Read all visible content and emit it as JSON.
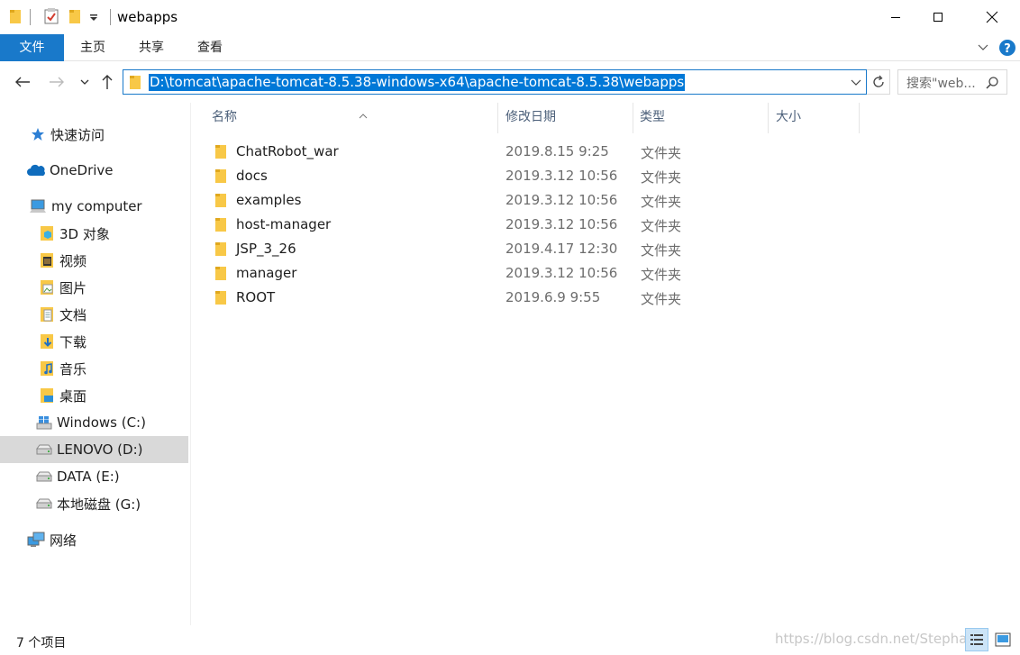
{
  "window": {
    "title": "webapps",
    "minimize_label": "minimize",
    "maximize_label": "maximize",
    "close_label": "close"
  },
  "ribbon": {
    "tabs": [
      {
        "label": "文件"
      },
      {
        "label": "主页"
      },
      {
        "label": "共享"
      },
      {
        "label": "查看"
      }
    ]
  },
  "address": {
    "path": "D:\\tomcat\\apache-tomcat-8.5.38-windows-x64\\apache-tomcat-8.5.38\\webapps"
  },
  "search": {
    "placeholder": "搜索\"web..."
  },
  "nav_pane": {
    "quick_access": "快速访问",
    "onedrive": "OneDrive",
    "this_pc": "my computer",
    "items": [
      {
        "label": "3D 对象"
      },
      {
        "label": "视频"
      },
      {
        "label": "图片"
      },
      {
        "label": "文档"
      },
      {
        "label": "下载"
      },
      {
        "label": "音乐"
      },
      {
        "label": "桌面"
      },
      {
        "label": "Windows (C:)"
      },
      {
        "label": "LENOVO (D:)"
      },
      {
        "label": "DATA (E:)"
      },
      {
        "label": "本地磁盘 (G:)"
      }
    ],
    "network": "网络"
  },
  "columns": {
    "name": "名称",
    "date": "修改日期",
    "type": "类型",
    "size": "大小"
  },
  "files": [
    {
      "name": "ChatRobot_war",
      "date": "2019.8.15 9:25",
      "type": "文件夹"
    },
    {
      "name": "docs",
      "date": "2019.3.12 10:56",
      "type": "文件夹"
    },
    {
      "name": "examples",
      "date": "2019.3.12 10:56",
      "type": "文件夹"
    },
    {
      "name": "host-manager",
      "date": "2019.3.12 10:56",
      "type": "文件夹"
    },
    {
      "name": "JSP_3_26",
      "date": "2019.4.17 12:30",
      "type": "文件夹"
    },
    {
      "name": "manager",
      "date": "2019.3.12 10:56",
      "type": "文件夹"
    },
    {
      "name": "ROOT",
      "date": "2019.6.9 9:55",
      "type": "文件夹"
    }
  ],
  "status": {
    "item_count": "7 个项目",
    "watermark": "https://blog.csdn.net/Stephan..."
  },
  "colors": {
    "accent": "#1979ca",
    "selection": "#0078d7",
    "folder": "#f8c847",
    "nav_selected": "#d9d9d9"
  }
}
